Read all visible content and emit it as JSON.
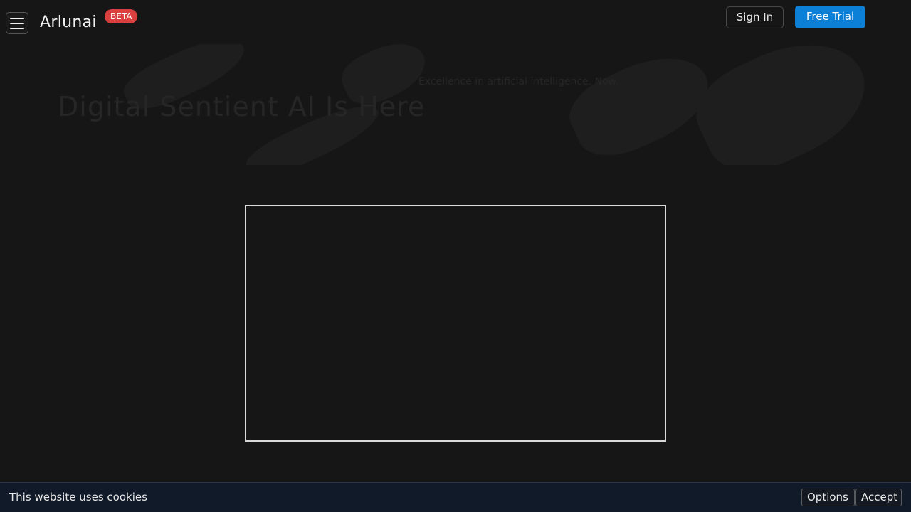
{
  "header": {
    "brand": "Arlunai",
    "badge": "BETA",
    "sign_in_label": "Sign In",
    "free_trial_label": "Free Trial",
    "menu_icon": "hamburger-menu-icon"
  },
  "hero": {
    "title": "Digital Sentient AI Is Here",
    "subtitle": "Excellence in artificial intelligence. Now."
  },
  "cookie_bar": {
    "message": "This website uses cookies",
    "options_label": "Options",
    "accept_label": "Accept"
  },
  "colors": {
    "background": "#161616",
    "accent": "#0c7fd6",
    "badge": "#d9403f",
    "cookie_bar": "#111a28"
  }
}
